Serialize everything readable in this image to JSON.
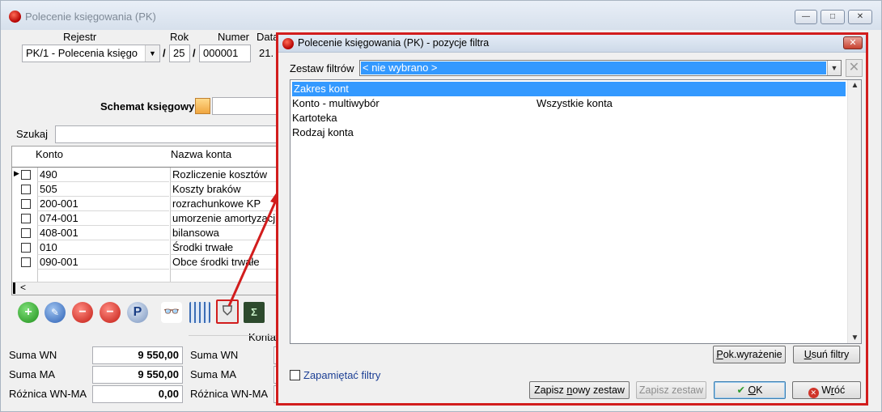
{
  "back_window": {
    "title": "Polecenie księgowania (PK)",
    "controls": {
      "minimize": "—",
      "maximize": "□",
      "close": "✕"
    },
    "rejestr_label": "Rejestr",
    "rok_label": "Rok",
    "numer_label": "Numer",
    "data_label": "Data",
    "rejestr_value": "PK/1  - Polecenia księgo",
    "rok_value": "25",
    "numer_value": "000001",
    "data_value": "21.",
    "separator": "/",
    "schemat_label": "Schemat księgowy",
    "szukaj_label": "Szukaj",
    "grid": {
      "columns": [
        "Konto",
        "Nazwa konta"
      ],
      "rows": [
        {
          "konto": "490",
          "nazwa": "Rozliczenie kosztów"
        },
        {
          "konto": "505",
          "nazwa": "Koszty braków"
        },
        {
          "konto": "200-001",
          "nazwa": "rozrachunkowe KP"
        },
        {
          "konto": "074-001",
          "nazwa": "umorzenie amortyzacji"
        },
        {
          "konto": "408-001",
          "nazwa": "bilansowa"
        },
        {
          "konto": "010",
          "nazwa": "Środki trwałe"
        },
        {
          "konto": "090-001",
          "nazwa": "Obce środki trwałe"
        }
      ],
      "scroll_left": "<"
    },
    "toolbar_icons": [
      "add-icon",
      "edit-icon",
      "delete-icon",
      "delete-confirm-icon",
      "post-icon",
      "binoculars-icon",
      "calendar-grid-icon",
      "filter-icon",
      "sum-icon"
    ],
    "konta_label": "Konta",
    "totals_left": [
      {
        "label": "Suma WN",
        "value": "9 550,00"
      },
      {
        "label": "Suma MA",
        "value": "9 550,00"
      },
      {
        "label": "Różnica WN-MA",
        "value": "0,00"
      }
    ],
    "totals_right": [
      {
        "label": "Suma WN"
      },
      {
        "label": "Suma MA"
      },
      {
        "label": "Różnica WN-MA"
      }
    ]
  },
  "dialog": {
    "title": "Polecenie księgowania (PK) - pozycje filtra",
    "close_glyph": "✕",
    "zestaw_label": "Zestaw filtrów",
    "zestaw_value": "< nie wybrano >",
    "filters": [
      {
        "name": "Zakres kont",
        "value": "",
        "selected": true
      },
      {
        "name": "Konto - multiwybór",
        "value": "Wszystkie konta",
        "selected": false
      },
      {
        "name": "Kartoteka",
        "value": "",
        "selected": false
      },
      {
        "name": "Rodzaj konta",
        "value": "",
        "selected": false
      }
    ],
    "buttons": {
      "pok_wyrazenie": {
        "pre": "P",
        "post": "ok.wyrażenie"
      },
      "usun_filtry": {
        "pre": "U",
        "post": "suń filtry"
      },
      "zapisz_nowy": {
        "pre": "Zapisz ",
        "u": "n",
        "post": "owy zestaw"
      },
      "zapisz_zestaw": "Zapisz zestaw",
      "ok": {
        "u": "O",
        "post": "K"
      },
      "wroc": {
        "pre": "W",
        "u": "r",
        "post": "óć"
      }
    },
    "remember_label": "Zapamiętać filtry"
  },
  "colors": {
    "highlight_border": "#d21d1d",
    "selection": "#3399ff",
    "link_text": "#1c3f95"
  }
}
